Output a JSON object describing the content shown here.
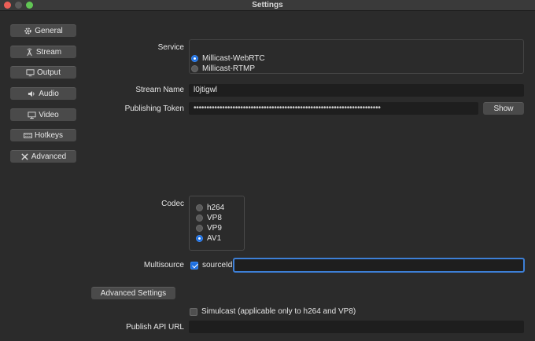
{
  "window": {
    "title": "Settings"
  },
  "sidebar": {
    "items": [
      {
        "label": "General",
        "icon": "gear-icon"
      },
      {
        "label": "Stream",
        "icon": "antenna-icon"
      },
      {
        "label": "Output",
        "icon": "monitor-icon"
      },
      {
        "label": "Audio",
        "icon": "speaker-icon"
      },
      {
        "label": "Video",
        "icon": "display-icon"
      },
      {
        "label": "Hotkeys",
        "icon": "keyboard-icon"
      },
      {
        "label": "Advanced",
        "icon": "tools-icon"
      }
    ]
  },
  "service": {
    "label": "Service",
    "options": [
      {
        "label": "Millicast-WebRTC",
        "selected": true
      },
      {
        "label": "Millicast-RTMP",
        "selected": false
      }
    ]
  },
  "stream_name": {
    "label": "Stream Name",
    "value": "l0jtigwl"
  },
  "publishing_token": {
    "label": "Publishing Token",
    "value": "••••••••••••••••••••••••••••••••••••••••••••••••••••••••••••••••••••••••",
    "show_label": "Show"
  },
  "codec": {
    "label": "Codec",
    "options": [
      {
        "label": "h264",
        "selected": false
      },
      {
        "label": "VP8",
        "selected": false
      },
      {
        "label": "VP9",
        "selected": false
      },
      {
        "label": "AV1",
        "selected": true
      }
    ]
  },
  "multisource": {
    "label": "Multisource",
    "checkbox_label": "sourceId",
    "checked": true,
    "value": ""
  },
  "advanced_settings": {
    "label": "Advanced Settings"
  },
  "simulcast": {
    "label": "Simulcast (applicable only to h264 and VP8)",
    "checked": false
  },
  "publish_api_url": {
    "label": "Publish API URL",
    "value": ""
  },
  "colors": {
    "accent": "#1d6fe0",
    "background": "#2b2b2b",
    "field": "#1e1e1e",
    "button": "#4a4a4a"
  }
}
